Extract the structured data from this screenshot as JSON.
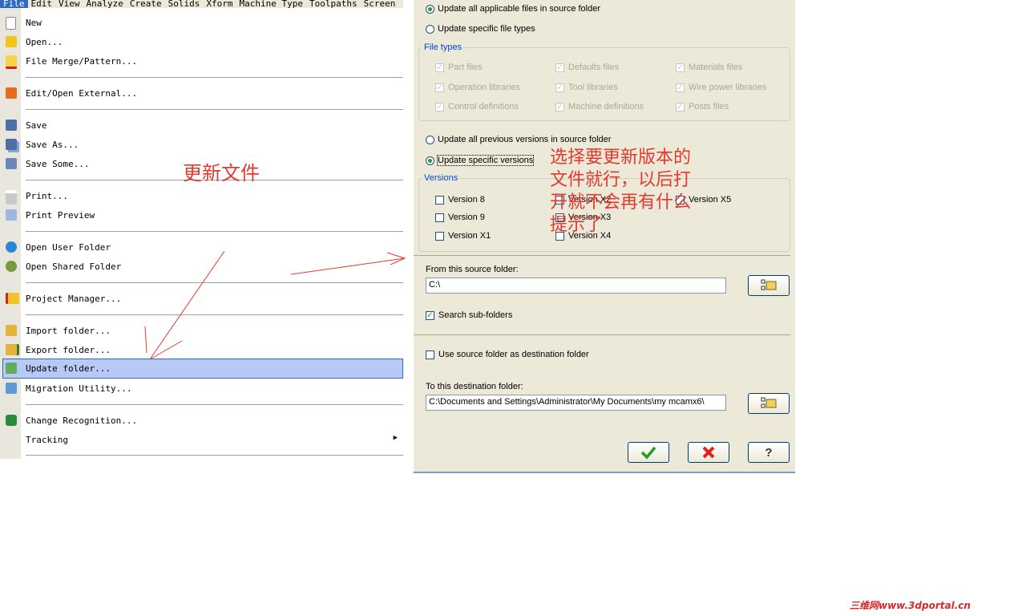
{
  "menubar": [
    "File",
    "Edit",
    "View",
    "Analyze",
    "Create",
    "Solids",
    "Xform",
    "Machine Type",
    "Toolpaths",
    "Screen"
  ],
  "file_menu": {
    "items": [
      {
        "label": "New",
        "icon": "new-file-icon"
      },
      {
        "label": "Open...",
        "icon": "open-folder-icon"
      },
      {
        "label": "File Merge/Pattern...",
        "icon": "file-merge-icon"
      },
      {
        "label": "Edit/Open External...",
        "icon": "edit-external-icon"
      },
      {
        "label": "Save",
        "icon": "save-icon"
      },
      {
        "label": "Save As...",
        "icon": "save-as-icon"
      },
      {
        "label": "Save Some...",
        "icon": "save-some-icon"
      },
      {
        "label": "Print...",
        "icon": "printer-icon"
      },
      {
        "label": "Print Preview",
        "icon": "print-preview-icon"
      },
      {
        "label": "Open User Folder",
        "icon": "user-folder-icon"
      },
      {
        "label": "Open Shared Folder",
        "icon": "shared-folder-icon"
      },
      {
        "label": "Project Manager...",
        "icon": "project-manager-icon"
      },
      {
        "label": "Import folder...",
        "icon": "import-folder-icon"
      },
      {
        "label": "Export folder...",
        "icon": "export-folder-icon"
      },
      {
        "label": "Update folder...",
        "icon": "update-folder-icon"
      },
      {
        "label": "Migration Utility...",
        "icon": "migration-icon"
      },
      {
        "label": "Change Recognition...",
        "icon": "change-recognition-icon"
      },
      {
        "label": "Tracking",
        "icon": ""
      }
    ],
    "selected": "Update folder..."
  },
  "dialog": {
    "radio_all_files": "Update all applicable files in source folder",
    "radio_specific_types": "Update specific file types",
    "file_types_title": "File types",
    "file_types": [
      "Part files",
      "Defaults files",
      "Materials files",
      "Operation libraries",
      "Tool libraries",
      "Wire power libraries",
      "Control definitions",
      "Machine definitions",
      "Posts files"
    ],
    "radio_all_versions": "Update all previous versions in source folder",
    "radio_specific_versions": "Update specific versions",
    "versions_title": "Versions",
    "versions": [
      "Version 8",
      "Version X2",
      "Version X5",
      "Version 9",
      "Version X3",
      "Version X1",
      "Version X4"
    ],
    "source_label": "From this source folder:",
    "source_value": "C:\\",
    "search_subfolders": "Search sub-folders",
    "use_source_as_dest": "Use source folder as destination folder",
    "dest_label": "To this destination folder:",
    "dest_value": "C:\\Documents and Settings\\Administrator\\My Documents\\my mcamx6\\",
    "colors": {
      "ok": "#21a121",
      "cancel": "#e0231d",
      "group_title": "#0046d5"
    }
  },
  "annotations": {
    "update_file": "更新文件",
    "instruction_1": "选择要更新版本的",
    "instruction_2": "文件就行，以后打",
    "instruction_3": "开就不会再有什么",
    "instruction_4": "提示了",
    "color": "#e23a2e"
  },
  "watermark": "三维网www.3dportal.cn"
}
